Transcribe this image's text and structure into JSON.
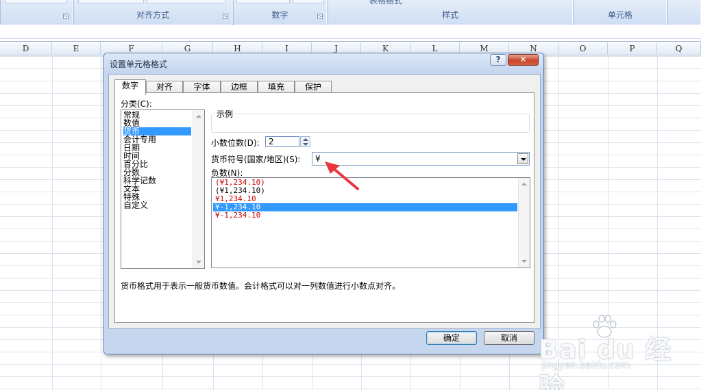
{
  "ribbon": {
    "groups": [
      {
        "label": "",
        "partial": ""
      },
      {
        "label": "对齐方式"
      },
      {
        "label": "数字"
      },
      {
        "label": "样式",
        "partial": "表格格式"
      },
      {
        "label": "单元格"
      }
    ]
  },
  "sheet": {
    "columns": [
      "D",
      "E",
      "F",
      "G",
      "H",
      "I",
      "J",
      "K",
      "L",
      "M",
      "N",
      "O",
      "P",
      "Q"
    ]
  },
  "dialog": {
    "title": "设置单元格格式",
    "help": "?",
    "close": "✕",
    "tabs": [
      "数字",
      "对齐",
      "字体",
      "边框",
      "填充",
      "保护"
    ],
    "category_label": "分类(C):",
    "categories": [
      "常规",
      "数值",
      "货币",
      "会计专用",
      "日期",
      "时间",
      "百分比",
      "分数",
      "科学记数",
      "文本",
      "特殊",
      "自定义"
    ],
    "selected_category": "货币",
    "sample_label": "示例",
    "decimal_label": "小数位数(D):",
    "decimal_value": "2",
    "currency_label": "货币符号(国家/地区)(S):",
    "currency_value": "¥",
    "negative_label": "负数(N):",
    "negative_formats": [
      {
        "text": "(¥1,234.10)",
        "color": "#cc0000"
      },
      {
        "text": "(¥1,234.10)",
        "color": "#000000"
      },
      {
        "text": "¥1,234.10",
        "color": "#cc0000"
      },
      {
        "text": "¥-1,234.10",
        "color": "#ffffff",
        "selected": true
      },
      {
        "text": "¥-1,234.10",
        "color": "#cc0000"
      }
    ],
    "description": "货币格式用于表示一般货币数值。会计格式可以对一列数值进行小数点对齐。",
    "ok": "确定",
    "cancel": "取消"
  },
  "watermark": {
    "brand": "Bai du 经验",
    "url": "jingyan.baidu.com"
  },
  "colors": {
    "selection": "#3399ff",
    "annotation_arrow": "#e8383d",
    "negative_red": "#cc0000"
  }
}
